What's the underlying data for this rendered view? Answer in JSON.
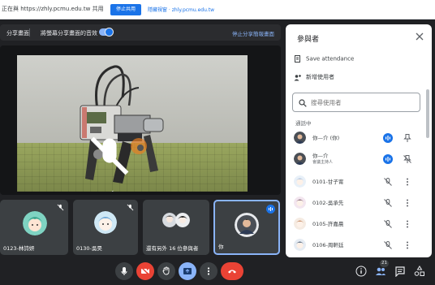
{
  "topbar": {
    "share_text": "正在與 https://zhly.pcmu.edu.tw 共用",
    "stop_label": "停止共用",
    "hide_label": "隱藏視窗 · zhly.pcmu.edu.tw"
  },
  "presentation": {
    "title": "分享畫面",
    "sound_label": "將螢幕分享畫面的音效",
    "stop_share_label": "停止分享簡報畫面"
  },
  "tiles": [
    {
      "name": "0123-林詩妍"
    },
    {
      "name": "0130-吳昊"
    },
    {
      "name": "還有另外 16 位參與者"
    },
    {
      "name": "你"
    }
  ],
  "controls": {
    "participants_count": "21"
  },
  "panel": {
    "title": "參與者",
    "save_attendance": "Save attendance",
    "add_people": "新增使用者",
    "search_placeholder": "搜尋使用者",
    "section_label": "通話中",
    "participants": [
      {
        "name": "你—介 (你)",
        "sub": ""
      },
      {
        "name": "你—介",
        "sub": "會議主持人"
      },
      {
        "name": "0101-甘子甯",
        "sub": ""
      },
      {
        "name": "0102-吳承先",
        "sub": ""
      },
      {
        "name": "0105-許嘉晨",
        "sub": ""
      },
      {
        "name": "0106-周軒廷",
        "sub": ""
      }
    ]
  },
  "colors": {
    "accent": "#1a73e8",
    "hangup": "#ea4335",
    "background": "#202124"
  }
}
